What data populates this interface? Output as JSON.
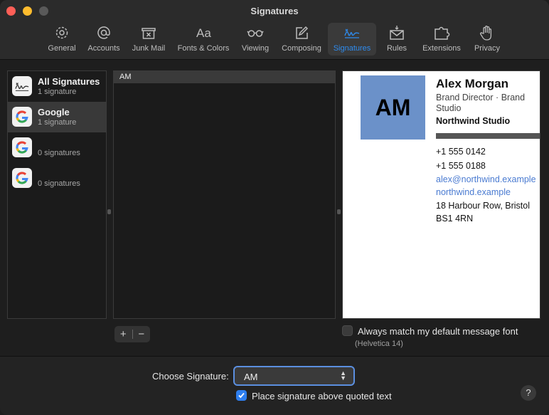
{
  "window": {
    "title": "Signatures"
  },
  "toolbar": {
    "items": [
      {
        "label": "General",
        "icon": "gear-icon"
      },
      {
        "label": "Accounts",
        "icon": "at-icon"
      },
      {
        "label": "Junk Mail",
        "icon": "junk-tray-icon"
      },
      {
        "label": "Fonts & Colors",
        "icon": "font-icon"
      },
      {
        "label": "Viewing",
        "icon": "glasses-icon"
      },
      {
        "label": "Composing",
        "icon": "compose-icon"
      },
      {
        "label": "Signatures",
        "icon": "signature-icon"
      },
      {
        "label": "Rules",
        "icon": "rules-envelope-icon"
      },
      {
        "label": "Extensions",
        "icon": "puzzle-icon"
      },
      {
        "label": "Privacy",
        "icon": "hand-icon"
      }
    ],
    "active": "Signatures",
    "active_color": "#2e8cf0"
  },
  "accounts": [
    {
      "name": "All Signatures",
      "count": "1 signature",
      "icon": "signature-icon"
    },
    {
      "name": "Google",
      "count": "1 signature",
      "icon": "google-icon"
    },
    {
      "name": "",
      "count": "0 signatures",
      "icon": "google-icon"
    },
    {
      "name": "",
      "count": "0 signatures",
      "icon": "google-icon"
    }
  ],
  "signatures": [
    {
      "name": "AM"
    }
  ],
  "preview": {
    "initials": "AM",
    "name": "Alex Morgan",
    "role": "Brand Director · Brand Studio",
    "company": "Northwind Studio",
    "phone1": "+1 555 0142",
    "phone2": "+1 555 0188",
    "email": "alex@northwind.example",
    "website": "northwind.example",
    "address1": "18 Harbour Row, Bristol",
    "address2": "BS1 4RN",
    "avatar_color": "#6b91c9",
    "link_color": "#4a7bd1"
  },
  "controls": {
    "add_label": "+",
    "remove_label": "−",
    "match_font_label": "Always match my default message font",
    "match_font_sub": "(Helvetica 14)",
    "match_font_checked": false,
    "choose_label": "Choose Signature:",
    "choose_value": "AM",
    "place_above_label": "Place signature above quoted text",
    "place_above_checked": true,
    "help_label": "?"
  }
}
